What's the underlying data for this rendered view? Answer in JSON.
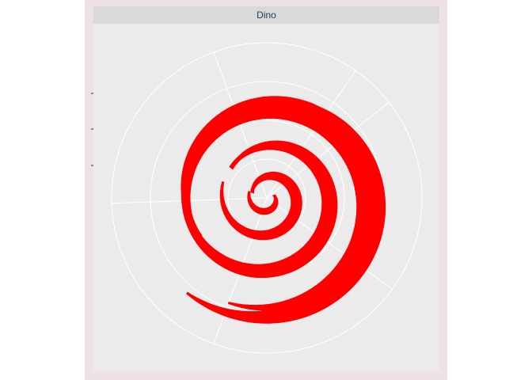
{
  "panel": {
    "strip_label": "Dino"
  },
  "colors": {
    "fill": "#ff0000",
    "panel_background": "#ebebeb",
    "strip_background": "#d9d9d9",
    "figure_background": "#ede3e7",
    "grid": "#ffffff",
    "strip_text": "#1a3a5c"
  },
  "chart_data": {
    "type": "area",
    "coordinate_system": "polar",
    "title": "",
    "xlabel": "",
    "ylabel": "",
    "grid": true,
    "legend": "none",
    "y_tick_labels": [
      "",
      "",
      ""
    ],
    "series": [
      {
        "values": [
          [
            0.05,
            0.25
          ],
          [
            0.08,
            0.45
          ],
          [
            0.25,
            0.6
          ],
          [
            0.14,
            0.8
          ],
          [
            0.6,
            0.94
          ],
          [
            0.55,
            0.92
          ]
        ]
      }
    ]
  }
}
